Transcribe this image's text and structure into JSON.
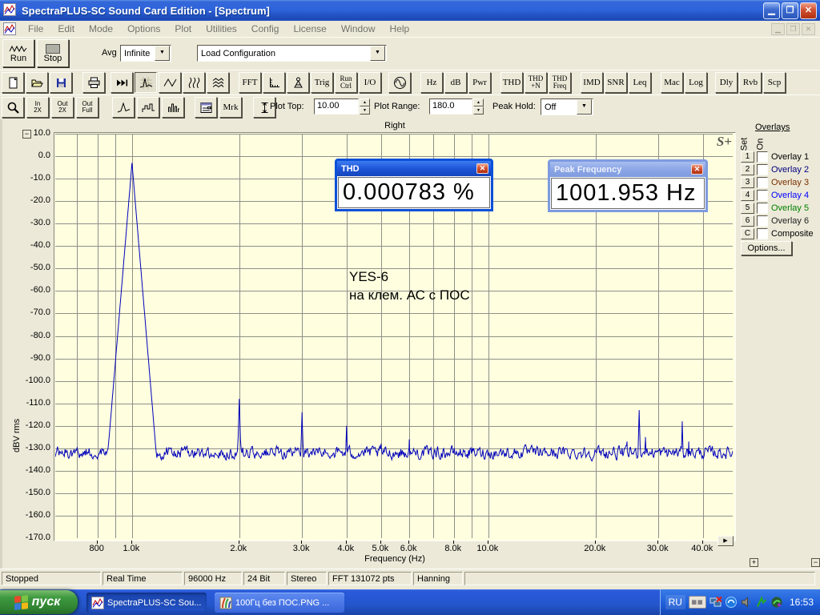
{
  "window": {
    "title": "SpectraPLUS-SC Sound Card Edition - [Spectrum]"
  },
  "menu": {
    "items": [
      "File",
      "Edit",
      "Mode",
      "Options",
      "Plot",
      "Utilities",
      "Config",
      "License",
      "Window",
      "Help"
    ]
  },
  "transport": {
    "run_label": "Run",
    "stop_label": "Stop",
    "avg_label": "Avg",
    "avg_value": "Infinite",
    "config_value": "Load Configuration"
  },
  "toolbar_icons": {
    "groups": [
      [
        {
          "n": "new-file-button",
          "t": "icon",
          "v": "new"
        },
        {
          "n": "open-button",
          "t": "icon",
          "v": "open"
        },
        {
          "n": "save-button",
          "t": "icon",
          "v": "save"
        }
      ],
      [
        {
          "n": "print-button",
          "t": "icon",
          "v": "print"
        }
      ],
      [
        {
          "n": "fast-process-button",
          "t": "icon",
          "v": "ffwd"
        }
      ],
      [
        {
          "n": "spectrum-view-button",
          "t": "icon",
          "v": "spectrum",
          "pressed": true
        },
        {
          "n": "time-series-view-button",
          "t": "icon",
          "v": "timeseries"
        },
        {
          "n": "spectrogram-view-button",
          "t": "icon",
          "v": "spectrogram"
        },
        {
          "n": "surface-view-button",
          "t": "icon",
          "v": "surface"
        }
      ],
      [
        {
          "n": "fft-settings-button",
          "t": "text",
          "v": "FFT"
        },
        {
          "n": "scaling-button",
          "t": "icon",
          "v": "ruler"
        },
        {
          "n": "calibration-button",
          "t": "icon",
          "v": "mic"
        },
        {
          "n": "trigger-button",
          "t": "text",
          "v": "Trig"
        },
        {
          "n": "run-control-button",
          "t": "text2",
          "v": "Run|Ctrl"
        },
        {
          "n": "io-button",
          "t": "text",
          "v": "I/O"
        }
      ],
      [
        {
          "n": "signal-generator-button",
          "t": "icon",
          "v": "sine"
        }
      ],
      [
        {
          "n": "hz-button",
          "t": "text",
          "v": "Hz"
        },
        {
          "n": "db-button",
          "t": "text",
          "v": "dB"
        },
        {
          "n": "pwr-button",
          "t": "text",
          "v": "Pwr"
        }
      ],
      [
        {
          "n": "thd-button",
          "t": "text",
          "v": "THD"
        },
        {
          "n": "thd-n-button",
          "t": "text2",
          "v": "THD|+N"
        },
        {
          "n": "thd-freq-button",
          "t": "text2",
          "v": "THD|Freq"
        }
      ],
      [
        {
          "n": "imd-button",
          "t": "text",
          "v": "IMD"
        },
        {
          "n": "snr-button",
          "t": "text",
          "v": "SNR"
        },
        {
          "n": "leq-button",
          "t": "text",
          "v": "Leq"
        }
      ],
      [
        {
          "n": "macro-button",
          "t": "text",
          "v": "Mac"
        },
        {
          "n": "logging-button",
          "t": "text",
          "v": "Log"
        }
      ],
      [
        {
          "n": "delay-button",
          "t": "text",
          "v": "Dly"
        },
        {
          "n": "reverb-button",
          "t": "text",
          "v": "Rvb"
        },
        {
          "n": "scope-button",
          "t": "text",
          "v": "Scp"
        }
      ]
    ]
  },
  "toolbar_plot": {
    "groups": [
      [
        {
          "n": "zoom-button",
          "t": "icon",
          "v": "magnify"
        },
        {
          "n": "zoom-in-2x-button",
          "t": "text2s",
          "v": "In|2X"
        },
        {
          "n": "zoom-out-2x-button",
          "t": "text2s",
          "v": "Out|2X"
        },
        {
          "n": "zoom-out-full-button",
          "t": "text2s",
          "v": "Out|Full"
        }
      ],
      [
        {
          "n": "line-plot-style-button",
          "t": "icon",
          "v": "peakcurve"
        },
        {
          "n": "step-plot-style-button",
          "t": "icon",
          "v": "stepcurve"
        },
        {
          "n": "bar-plot-style-button",
          "t": "icon",
          "v": "barcurve"
        }
      ],
      [
        {
          "n": "display-options-button",
          "t": "icon",
          "v": "dialog"
        },
        {
          "n": "marker-button",
          "t": "text",
          "v": "Mrk"
        }
      ],
      [
        {
          "n": "autoscale-button",
          "t": "icon",
          "v": "vruler"
        }
      ]
    ],
    "plot_top_label": "Plot Top:",
    "plot_top_value": "10.00",
    "plot_range_label": "Plot Range:",
    "plot_range_value": "180.0",
    "peak_hold_label": "Peak Hold:",
    "peak_hold_value": "Off"
  },
  "plot": {
    "channel": "Right",
    "ylabel": "dBV rms",
    "xlabel": "Frequency (Hz)",
    "logo": "S+",
    "annotation_line1": "YES-6",
    "annotation_line2": "на клем. АС с ПОС"
  },
  "thd_window": {
    "title": "THD",
    "value": "0.000783 %"
  },
  "peak_window": {
    "title": "Peak Frequency",
    "value": "1001.953 Hz"
  },
  "overlays": {
    "heading": "Overlays",
    "col_set": "Set",
    "col_on": "On",
    "options_label": "Options...",
    "items": [
      {
        "btn": "1",
        "label": "Overlay 1",
        "color": "#000000"
      },
      {
        "btn": "2",
        "label": "Overlay 2",
        "color": "#000080"
      },
      {
        "btn": "3",
        "label": "Overlay 3",
        "color": "#7B3000"
      },
      {
        "btn": "4",
        "label": "Overlay 4",
        "color": "#0000FF"
      },
      {
        "btn": "5",
        "label": "Overlay 5",
        "color": "#008000"
      },
      {
        "btn": "6",
        "label": "Overlay 6",
        "color": "#202020"
      },
      {
        "btn": "C",
        "label": "Composite",
        "color": "#000000"
      }
    ]
  },
  "status_bar": {
    "panels": [
      "Stopped",
      "Real Time",
      "96000 Hz",
      "24 Bit",
      "Stereo",
      "FFT 131072 pts",
      "Hanning"
    ]
  },
  "taskbar": {
    "start_label": "пуск",
    "tasks": [
      {
        "label": "SpectraPLUS-SC Sou...",
        "icon": "app",
        "active": true
      },
      {
        "label": "100Гц без ПОС.PNG ...",
        "icon": "image",
        "active": false
      }
    ],
    "lang": "RU",
    "clock": "16:53",
    "tray_icons": [
      "network-offline-icon",
      "messenger-icon",
      "volume-icon",
      "download-icon",
      "antivirus-icon"
    ]
  },
  "chart_data": {
    "type": "line",
    "title": "Right",
    "xlabel": "Frequency (Hz)",
    "ylabel": "dBV rms",
    "x_scale": "log",
    "x_range_hz": [
      609,
      48500
    ],
    "y_range_db": [
      -170,
      10
    ],
    "y_tick_step_db": 10,
    "grid_freqs_hz": [
      700,
      800,
      900,
      1000,
      2000,
      3000,
      4000,
      5000,
      6000,
      7000,
      8000,
      9000,
      10000,
      20000,
      30000,
      40000
    ],
    "x_ticks": [
      {
        "f": 800,
        "label": "800"
      },
      {
        "f": 1000,
        "label": "1.0k"
      },
      {
        "f": 2000,
        "label": "2.0k"
      },
      {
        "f": 3000,
        "label": "3.0k"
      },
      {
        "f": 4000,
        "label": "4.0k"
      },
      {
        "f": 5000,
        "label": "5.0k"
      },
      {
        "f": 6000,
        "label": "6.0k"
      },
      {
        "f": 8000,
        "label": "8.0k"
      },
      {
        "f": 10000,
        "label": "10.0k"
      },
      {
        "f": 20000,
        "label": "20.0k"
      },
      {
        "f": 30000,
        "label": "30.0k"
      },
      {
        "f": 40000,
        "label": "40.0k"
      }
    ],
    "noise_floor_db": -132,
    "noise_jitter_db": 1.6,
    "line_color": "#0000BB",
    "grid_color": "#8F8F87",
    "bg_color": "#FFFFE0",
    "peaks": [
      {
        "freq_hz": 1000,
        "db": -3,
        "slope_db_per_decade": 1900
      },
      {
        "freq_hz": 2000,
        "db": -108,
        "slope_db_per_decade": 5500
      },
      {
        "freq_hz": 3000,
        "db": -114,
        "slope_db_per_decade": 5500
      },
      {
        "freq_hz": 4000,
        "db": -120,
        "slope_db_per_decade": 5500
      },
      {
        "freq_hz": 5000,
        "db": -128,
        "slope_db_per_decade": 5500
      },
      {
        "freq_hz": 6000,
        "db": -126,
        "slope_db_per_decade": 5500
      },
      {
        "freq_hz": 24500,
        "db": -127,
        "slope_db_per_decade": 6000
      },
      {
        "freq_hz": 26500,
        "db": -113,
        "slope_db_per_decade": 6000
      },
      {
        "freq_hz": 27600,
        "db": -125,
        "slope_db_per_decade": 6000
      },
      {
        "freq_hz": 35000,
        "db": -118,
        "slope_db_per_decade": 6000
      },
      {
        "freq_hz": 36500,
        "db": -127,
        "slope_db_per_decade": 6000
      }
    ]
  }
}
